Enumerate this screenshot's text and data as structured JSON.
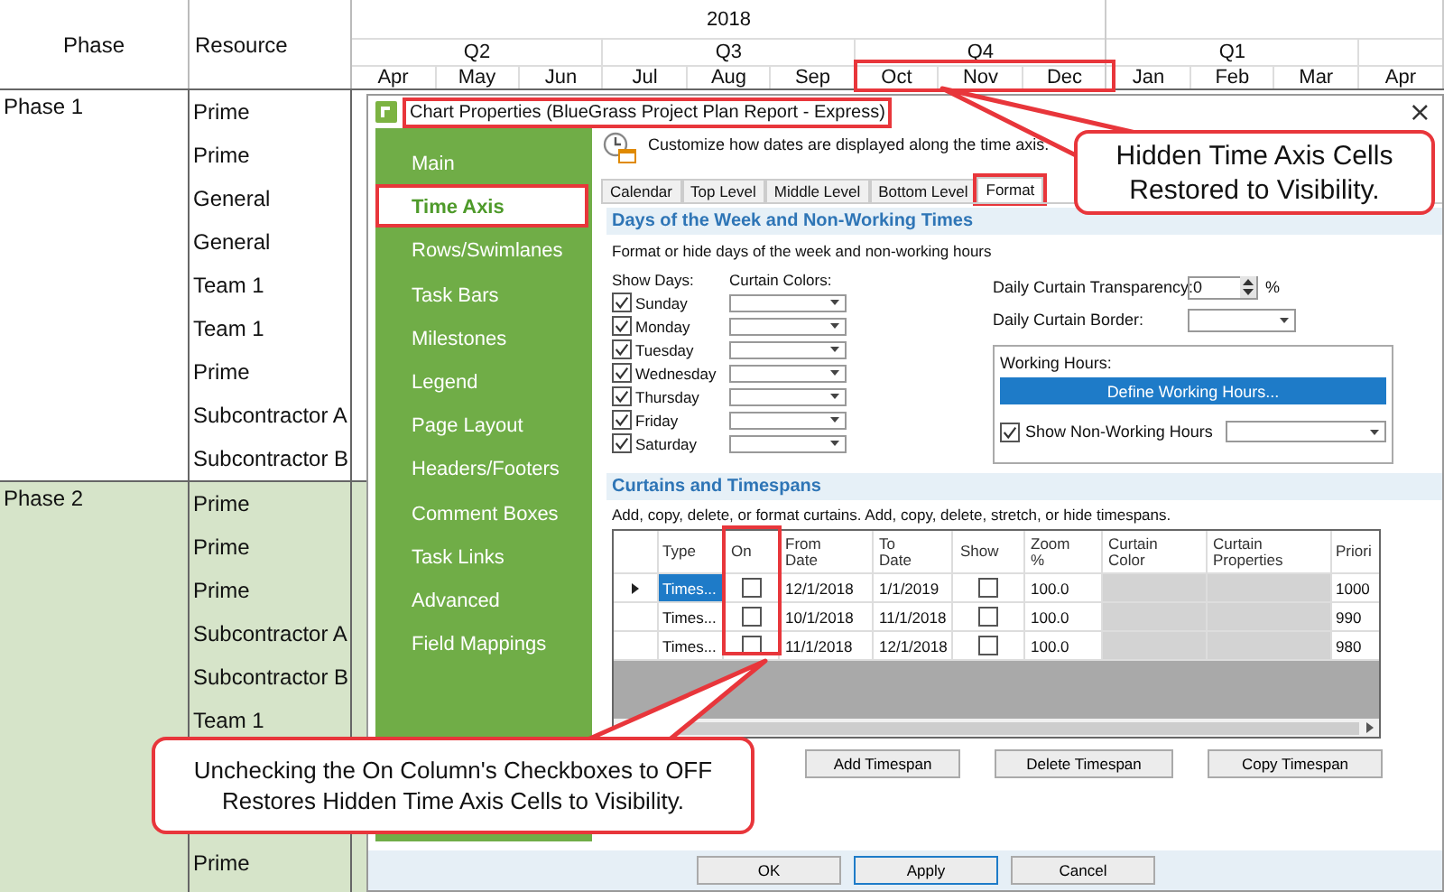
{
  "timeline": {
    "phase_heading": "Phase",
    "resource_heading": "Resource",
    "years": [
      {
        "label": "2018",
        "quarters": [
          {
            "label": "Q2",
            "months": [
              "Apr",
              "May",
              "Jun"
            ]
          },
          {
            "label": "Q3",
            "months": [
              "Jul",
              "Aug",
              "Sep"
            ]
          },
          {
            "label": "Q4",
            "months": [
              "Oct",
              "Nov",
              "Dec"
            ]
          }
        ]
      },
      {
        "quarters": [
          {
            "label": "Q1",
            "months": [
              "Jan",
              "Feb",
              "Mar"
            ]
          },
          {
            "months": [
              "Apr"
            ]
          }
        ]
      }
    ]
  },
  "phases": [
    {
      "name": "Phase 1",
      "shaded": false,
      "rows": [
        {
          "resource": "Prime"
        },
        {
          "resource": "Prime"
        },
        {
          "resource": "General"
        },
        {
          "resource": "General"
        },
        {
          "resource": "Team 1"
        },
        {
          "resource": "Team 1"
        },
        {
          "resource": "Prime"
        },
        {
          "resource": "Subcontractor A"
        },
        {
          "resource": "Subcontractor B"
        }
      ]
    },
    {
      "name": "Phase 2",
      "shaded": true,
      "rows": [
        {
          "resource": "Prime"
        },
        {
          "resource": "Prime"
        },
        {
          "resource": "Prime"
        },
        {
          "resource": "Subcontractor A"
        },
        {
          "resource": "Subcontractor B"
        },
        {
          "resource": "Team 1"
        },
        {
          "resource": "Prime"
        }
      ]
    }
  ],
  "dialog": {
    "title": "Chart Properties (BlueGrass Project Plan Report - Express)",
    "title_highlighted": true,
    "close": "×",
    "nav": [
      {
        "label": "Main",
        "selected": false,
        "highlighted": false
      },
      {
        "label": "Time Axis",
        "selected": true,
        "highlighted": true
      },
      {
        "label": "Rows/Swimlanes",
        "selected": false,
        "highlighted": false
      },
      {
        "label": "Task Bars",
        "selected": false,
        "highlighted": false
      },
      {
        "label": "Milestones",
        "selected": false,
        "highlighted": false
      },
      {
        "label": "Legend",
        "selected": false,
        "highlighted": false
      },
      {
        "label": "Page Layout",
        "selected": false,
        "highlighted": false
      },
      {
        "label": "Headers/Footers",
        "selected": false,
        "highlighted": false
      },
      {
        "label": "Comment Boxes",
        "selected": false,
        "highlighted": false
      },
      {
        "label": "Task Links",
        "selected": false,
        "highlighted": false
      },
      {
        "label": "Advanced",
        "selected": false,
        "highlighted": false
      },
      {
        "label": "Field Mappings",
        "selected": false,
        "highlighted": false
      }
    ],
    "intro": "Customize how dates are displayed along the time axis.",
    "tabs": [
      {
        "label": "Calendar",
        "selected": false,
        "highlighted": false
      },
      {
        "label": "Top Level",
        "selected": false,
        "highlighted": false
      },
      {
        "label": "Middle Level",
        "selected": false,
        "highlighted": false
      },
      {
        "label": "Bottom Level",
        "selected": false,
        "highlighted": false
      },
      {
        "label": "Format",
        "selected": true,
        "highlighted": true
      }
    ],
    "days_section": {
      "title": "Days of the Week and Non-Working Times",
      "description": "Format or hide days of the week and non-working hours",
      "show_days_label": "Show Days:",
      "curtain_colors_label": "Curtain Colors:",
      "days": [
        {
          "label": "Sunday",
          "checked": true
        },
        {
          "label": "Monday",
          "checked": true
        },
        {
          "label": "Tuesday",
          "checked": true
        },
        {
          "label": "Wednesday",
          "checked": true
        },
        {
          "label": "Thursday",
          "checked": true
        },
        {
          "label": "Friday",
          "checked": true
        },
        {
          "label": "Saturday",
          "checked": true
        }
      ],
      "transparency_label": "Daily Curtain Transparency:",
      "transparency_value": "0",
      "percent": "%",
      "border_label": "Daily Curtain Border:",
      "working_hours": {
        "label": "Working Hours:",
        "button": "Define Working Hours...",
        "show_label": "Show Non-Working Hours",
        "show_checked": true
      }
    },
    "curtains_section": {
      "title": "Curtains and Timespans",
      "description": "Add, copy, delete, or format curtains.  Add, copy, delete, stretch, or hide timespans.",
      "columns": [
        "Type",
        "On",
        "From\nDate",
        "To\nDate",
        "Show",
        "Zoom\n%",
        "Curtain\nColor",
        "Curtain\nProperties",
        "Priori"
      ],
      "rows": [
        {
          "current": true,
          "selected": true,
          "type": "Times...",
          "on": false,
          "from": "12/1/2018",
          "to": "1/1/2019",
          "show": false,
          "zoom": "100.0",
          "priority": "1000"
        },
        {
          "current": false,
          "selected": false,
          "type": "Times...",
          "on": false,
          "from": "10/1/2018",
          "to": "11/1/2018",
          "show": false,
          "zoom": "100.0",
          "priority": "990"
        },
        {
          "current": false,
          "selected": false,
          "type": "Times...",
          "on": false,
          "from": "11/1/2018",
          "to": "12/1/2018",
          "show": false,
          "zoom": "100.0",
          "priority": "980"
        }
      ],
      "buttons": [
        "Add Timespan",
        "Delete Timespan",
        "Copy Timespan"
      ]
    },
    "footer_buttons": [
      {
        "label": "OK",
        "focused": false
      },
      {
        "label": "Apply",
        "focused": true
      },
      {
        "label": "Cancel",
        "focused": false
      }
    ]
  },
  "callouts": [
    {
      "text": "Hidden Time Axis Cells\nRestored to Visibility."
    },
    {
      "text": "Unchecking the On Column's Checkboxes to OFF\nRestores Hidden Time Axis Cells to Visibility."
    }
  ]
}
